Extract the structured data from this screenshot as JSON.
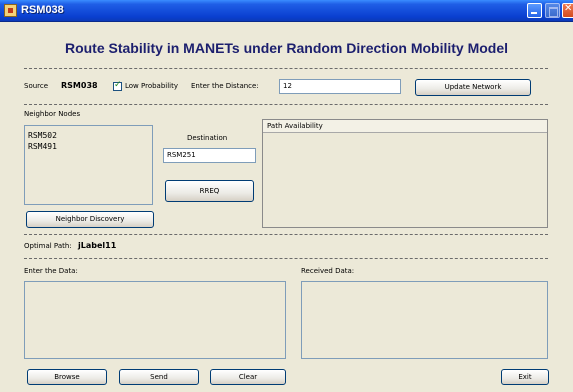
{
  "window": {
    "title": "RSM038"
  },
  "heading": "Route Stability in MANETs under Random Direction Mobility Model",
  "source": {
    "label": "Source",
    "value": "RSM038",
    "low_probability_label": "Low Probability",
    "low_probability_checked": true,
    "distance_label": "Enter the Distance:",
    "distance_value": "12",
    "update_button": "Update Network"
  },
  "neighbors": {
    "label": "Neighbor Nodes",
    "items": [
      "RSM502",
      "RSM491"
    ],
    "discovery_button": "Neighbor Discovery"
  },
  "destination": {
    "label": "Destination",
    "value": "RSM251",
    "rreq_button": "RREQ"
  },
  "path_availability": {
    "header": "Path Availability"
  },
  "optimal_path": {
    "label": "Optimal Path:",
    "value": "jLabel11"
  },
  "data": {
    "enter_label": "Enter the Data:",
    "received_label": "Received Data:"
  },
  "buttons": {
    "browse": "Browse",
    "send": "Send",
    "clear": "Clear",
    "exit": "Exit"
  },
  "colors": {
    "title_bar": "#0a3fd0",
    "heading": "#1c1f6e",
    "background": "#ece9d8"
  },
  "icons": {
    "app": "java-app-icon",
    "minimize": "minimize-icon",
    "maximize": "maximize-icon",
    "close": "close-icon",
    "check": "checkmark-icon"
  }
}
